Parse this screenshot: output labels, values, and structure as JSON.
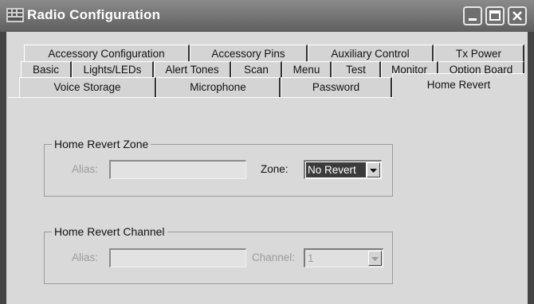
{
  "window": {
    "title": "Radio Configuration",
    "icon": "app-grid-icon",
    "controls": [
      "minimize-icon",
      "maximize-icon",
      "close-icon"
    ]
  },
  "tabs": {
    "row1": [
      "Accessory Configuration",
      "Accessory Pins",
      "Auxiliary Control",
      "Tx Power"
    ],
    "row2": [
      "Basic",
      "Lights/LEDs",
      "Alert Tones",
      "Scan",
      "Menu",
      "Test",
      "Monitor",
      "Option Board"
    ],
    "row3": [
      "Voice Storage",
      "Microphone",
      "Password",
      "Home Revert"
    ],
    "active": "Home Revert"
  },
  "home_revert_zone": {
    "legend": "Home Revert Zone",
    "alias_label": "Alias:",
    "alias_value": "",
    "zone_label": "Zone:",
    "zone_value": "No Revert"
  },
  "home_revert_channel": {
    "legend": "Home Revert Channel",
    "alias_label": "Alias:",
    "alias_value": "",
    "channel_label": "Channel:",
    "channel_value": "1"
  },
  "colors": {
    "titlebar": "#6f6f6f",
    "selection": "#3b3b3b",
    "disabled_text": "#9c9c9c"
  }
}
